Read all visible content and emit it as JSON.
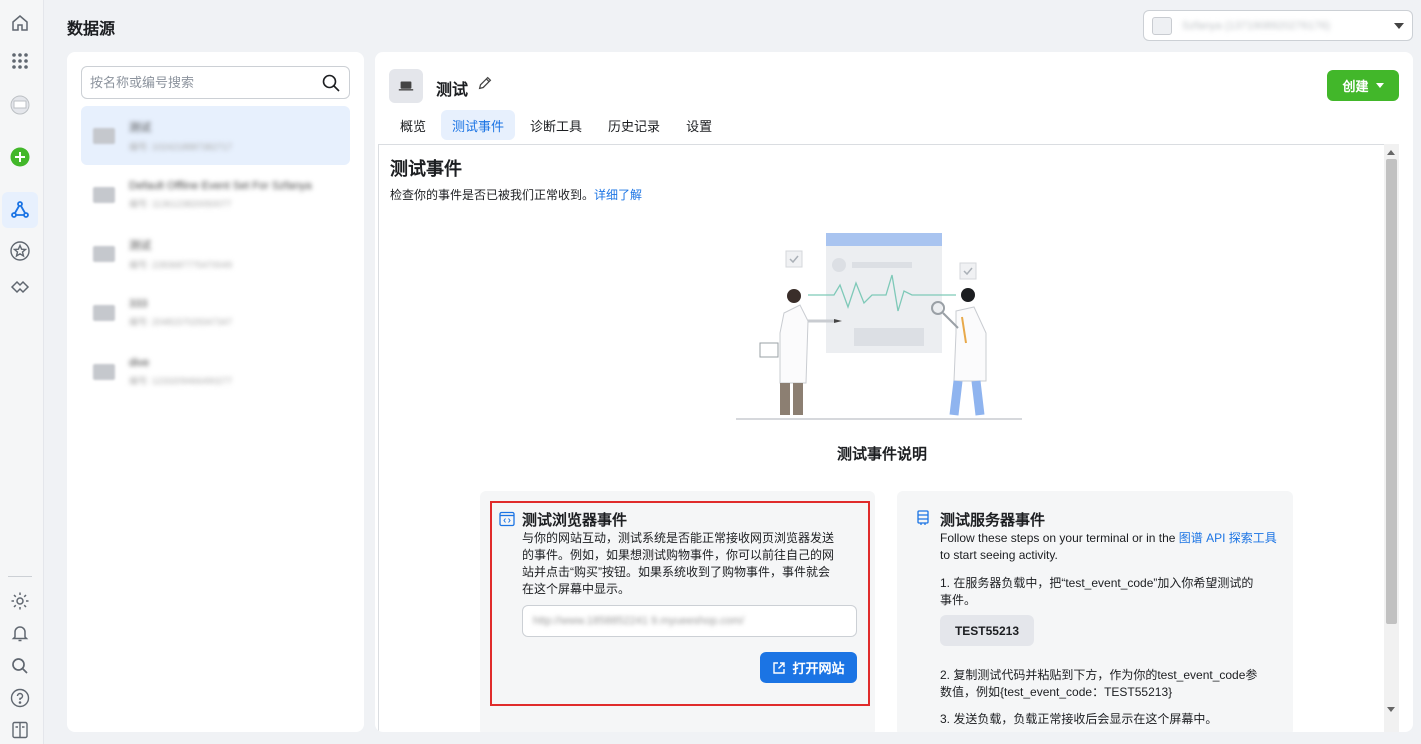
{
  "page": {
    "title": "数据源"
  },
  "account_selector": {
    "value": "Szfanya (1371908920276176)"
  },
  "rail": {
    "top_icons": [
      "home-icon",
      "apps-grid-icon",
      "account-avatar-icon",
      "add-icon",
      "data-sources-icon",
      "favorites-icon",
      "partners-icon"
    ],
    "bottom_icons": [
      "settings-icon",
      "notifications-icon",
      "search-icon",
      "help-icon",
      "panel-toggle-icon"
    ]
  },
  "search": {
    "placeholder": "按名称或编号搜索"
  },
  "datasources": [
    {
      "name": "测试",
      "id": "编号: 1024218887382717"
    },
    {
      "name": "Default Offline Event Set For Szfanya",
      "id": "编号: 1136123820050077"
    },
    {
      "name": "测试",
      "id": "编号: 2283687775470049"
    },
    {
      "name": "333",
      "id": "编号: 2048157029347347"
    },
    {
      "name": "dive",
      "id": "编号: 1233209466490277"
    }
  ],
  "pixel": {
    "name": "测试"
  },
  "create_button": {
    "label": "创建"
  },
  "tabs": [
    "概览",
    "测试事件",
    "诊断工具",
    "历史记录",
    "设置"
  ],
  "active_tab": "测试事件",
  "section": {
    "title": "测试事件",
    "description": "检查你的事件是否已被我们正常收到。",
    "learn_more": "详细了解",
    "illustration_caption": "测试事件说明"
  },
  "browser_card": {
    "title": "测试浏览器事件",
    "body_lines": [
      "与你的网站互动，测试系统是否能正常接收网页浏览器发送",
      "的事件。例如，如果想测试购物事件，你可以前往自己的网",
      "站并点击“购买”按钮。如果系统收到了购物事件，事件就会",
      "在这个屏幕中显示。"
    ],
    "url_value": "http://www.1858852241 9.myueeshop.com/",
    "open_button": "打开网站"
  },
  "server_card": {
    "title": "测试服务器事件",
    "intro_before_link": "Follow these steps on your terminal or in the ",
    "intro_link": "图谱 API 探索工具",
    "intro_after_link": " to start seeing activity.",
    "step1_lines": [
      "1. 在服务器负载中，把“test_event_code”加入你希望测试的",
      "事件。"
    ],
    "test_code": "TEST55213",
    "step2_lines": [
      "2. 复制测试代码并粘贴到下方，作为你的test_event_code参",
      "数值，例如{test_event_code：TEST55213}"
    ],
    "step3_partial": "3. 发送负载，负载正常接收后会显示在这个屏幕中。"
  },
  "colors": {
    "accent": "#1b74e4",
    "create_green": "#42b72a",
    "highlight_red": "#e02b2b",
    "page_bg": "#f0f2f5"
  }
}
